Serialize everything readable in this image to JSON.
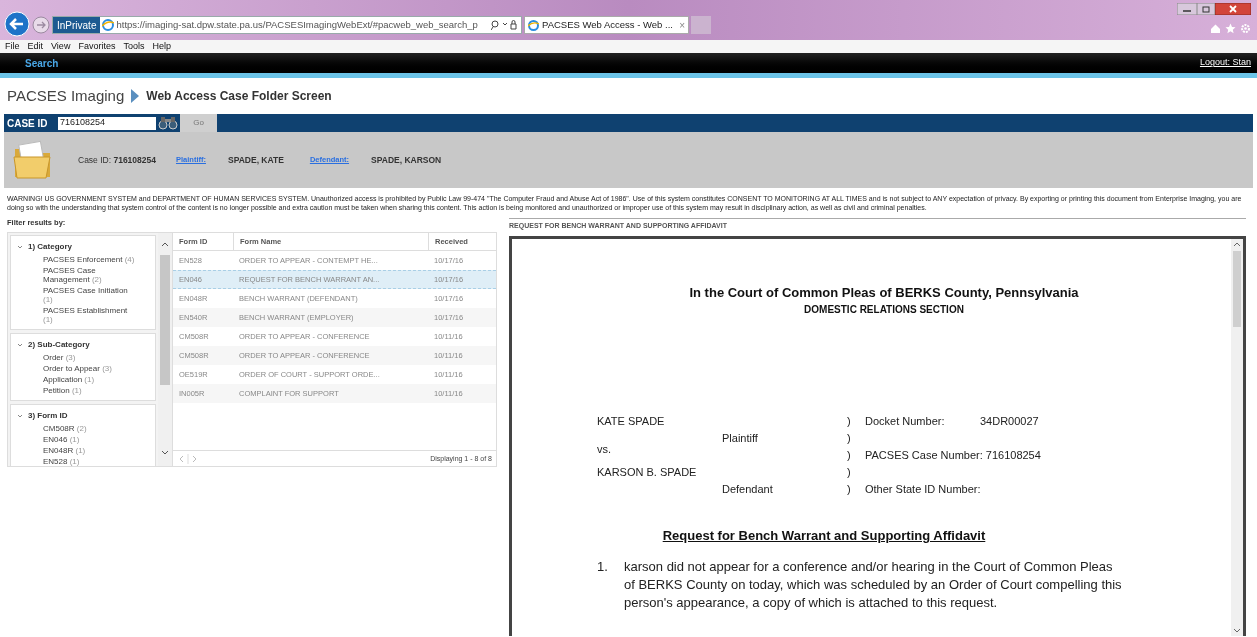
{
  "browser": {
    "private_badge": "InPrivate",
    "address": "https://imaging-sat.dpw.state.pa.us/PACSESImagingWebExt/#pacweb_web_search_p",
    "tab": {
      "title": "PACSES Web Access - Web ...",
      "close": "×"
    }
  },
  "menu": [
    "File",
    "Edit",
    "View",
    "Favorites",
    "Tools",
    "Help"
  ],
  "nav": {
    "search": "Search",
    "logout": "Logout: Stan"
  },
  "breadcrumb": {
    "app": "PACSES Imaging",
    "page": "Web Access Case Folder Screen"
  },
  "case_search": {
    "label": "CASE ID",
    "value": "716108254",
    "go": "Go",
    "go_disabled": true
  },
  "case_info": {
    "case_id_label": "Case ID:",
    "case_id": "716108254",
    "plaintiff_label": "Plaintiff:",
    "plaintiff": "SPADE, KATE",
    "defendant_label": "Defendant:",
    "defendant": "SPADE, KARSON"
  },
  "warning": "WARNING! US GOVERNMENT SYSTEM and DEPARTMENT OF HUMAN SERVICES SYSTEM. Unauthorized access is prohibited by Public Law 99-474 \"The Computer Fraud and Abuse Act of 1986\". Use of this system constitutes CONSENT TO MONITORING AT ALL TIMES and is not subject to ANY expectation of privacy. By exporting or printing this document from Enterprise Imaging, you are doing so with the understanding that system control of the content is no longer possible and extra caution must be taken when sharing this content. This action is being monitored and unauthorized or improper use of this system may result in disciplinary action, as well as civil and criminal penalties.",
  "filters": {
    "title": "Filter results by:",
    "groups": [
      {
        "title": "1) Category",
        "expanded": true,
        "items": [
          {
            "label": "PACSES Enforcement",
            "count": "(4)"
          },
          {
            "label": "PACSES Case Management",
            "count": "(2)"
          },
          {
            "label": "PACSES Case Initiation",
            "count": "(1)"
          },
          {
            "label": "PACSES Establishment",
            "count": "(1)"
          }
        ]
      },
      {
        "title": "2) Sub-Category",
        "expanded": true,
        "items": [
          {
            "label": "Order",
            "count": "(3)"
          },
          {
            "label": "Order to Appear",
            "count": "(3)"
          },
          {
            "label": "Application",
            "count": "(1)"
          },
          {
            "label": "Petition",
            "count": "(1)"
          }
        ]
      },
      {
        "title": "3) Form ID",
        "expanded": true,
        "items": [
          {
            "label": "CM508R",
            "count": "(2)"
          },
          {
            "label": "EN046",
            "count": "(1)"
          },
          {
            "label": "EN048R",
            "count": "(1)"
          },
          {
            "label": "EN528",
            "count": "(1)"
          }
        ]
      }
    ]
  },
  "table": {
    "columns": [
      "Form ID",
      "Form Name",
      "Received"
    ],
    "rows": [
      {
        "form_id": "EN528",
        "form_name": "ORDER TO APPEAR - CONTEMPT HE...",
        "received": "10/17/16",
        "selected": false
      },
      {
        "form_id": "EN046",
        "form_name": "REQUEST FOR BENCH WARRANT AN...",
        "received": "10/17/16",
        "selected": true
      },
      {
        "form_id": "EN048R",
        "form_name": "BENCH WARRANT (DEFENDANT)",
        "received": "10/17/16",
        "selected": false
      },
      {
        "form_id": "EN540R",
        "form_name": "BENCH WARRANT (EMPLOYER)",
        "received": "10/17/16",
        "selected": false
      },
      {
        "form_id": "CM508R",
        "form_name": "ORDER TO APPEAR - CONFERENCE",
        "received": "10/11/16",
        "selected": false
      },
      {
        "form_id": "CM508R",
        "form_name": "ORDER TO APPEAR - CONFERENCE",
        "received": "10/11/16",
        "selected": false
      },
      {
        "form_id": "OE519R",
        "form_name": "ORDER OF COURT - SUPPORT ORDE...",
        "received": "10/11/16",
        "selected": false
      },
      {
        "form_id": "IN005R",
        "form_name": "COMPLAINT FOR SUPPORT",
        "received": "10/11/16",
        "selected": false
      }
    ],
    "footer": "Displaying 1 - 8 of 8"
  },
  "document": {
    "title": "REQUEST FOR BENCH WARRANT AND SUPPORTING AFFIDAVIT",
    "court": "In the Court of Common Pleas of BERKS County, Pennsylvania",
    "section": "DOMESTIC RELATIONS SECTION",
    "plaintiff": "KATE SPADE",
    "plaintiff_role": "Plaintiff",
    "versus": "vs.",
    "defendant": "KARSON B. SPADE",
    "defendant_role": "Defendant",
    "paren": ")",
    "fields": [
      {
        "label": "Docket Number:",
        "value": "34DR00027"
      },
      {
        "label": "PACSES Case Number:",
        "value": "716108254"
      },
      {
        "label": "Other State ID Number:"
      }
    ],
    "heading": "Request for Bench Warrant and Supporting Affidavit",
    "paragraphs": [
      {
        "number": "1.",
        "text": "karson did not appear for a conference and/or hearing in the Court of Common Pleas of BERKS County on today, which was scheduled by an Order of Court compelling this person's appearance, a copy of which is attached to this request."
      }
    ]
  }
}
